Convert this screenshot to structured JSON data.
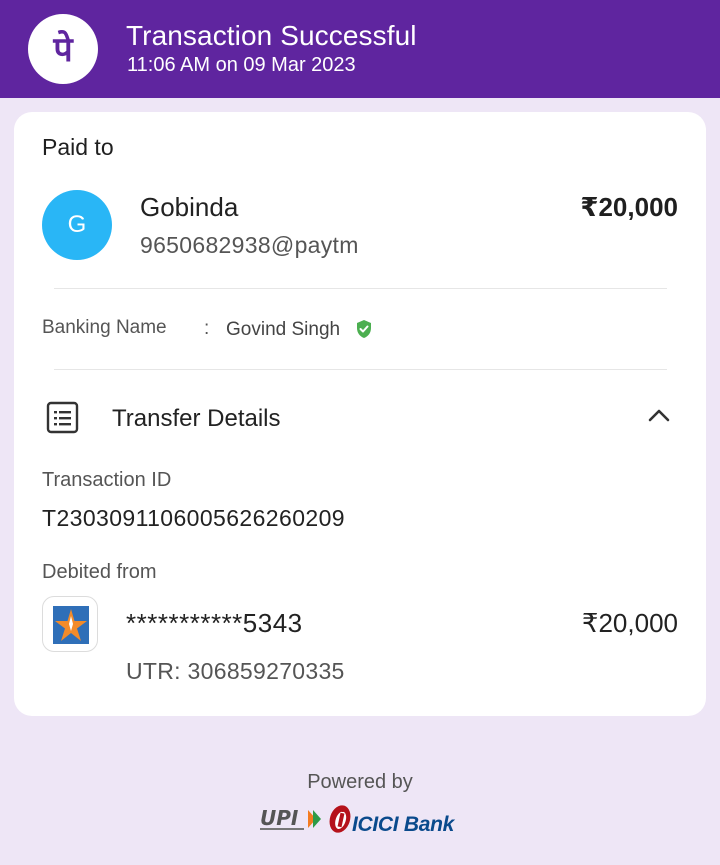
{
  "header": {
    "title": "Transaction Successful",
    "datetime": "11:06 AM on 09 Mar 2023",
    "logo_glyph": "पे",
    "brand_color": "#5f259f"
  },
  "paid_to": {
    "label": "Paid to",
    "avatar_initial": "G",
    "avatar_color": "#29b6f6",
    "name": "Gobinda",
    "upi_id": "9650682938@paytm",
    "amount": "₹20,000"
  },
  "banking": {
    "label": "Banking Name",
    "separator": ":",
    "value": "Govind Singh",
    "verified_icon": "verified-shield-icon",
    "verified_color": "#4caf50"
  },
  "transfer_details": {
    "title": "Transfer Details",
    "icon": "receipt-icon",
    "toggle_icon": "chevron-up-icon",
    "transaction_id_label": "Transaction ID",
    "transaction_id": "T2303091106005626260209",
    "debited_from_label": "Debited from",
    "bank_icon": "bank-logo-icon",
    "account_masked": "***********5343",
    "amount": "₹20,000",
    "utr": "UTR: 306859270335"
  },
  "footer": {
    "powered_by": "Powered by",
    "upi_logo": "UPI",
    "bank_logo": "ICICI Bank"
  }
}
